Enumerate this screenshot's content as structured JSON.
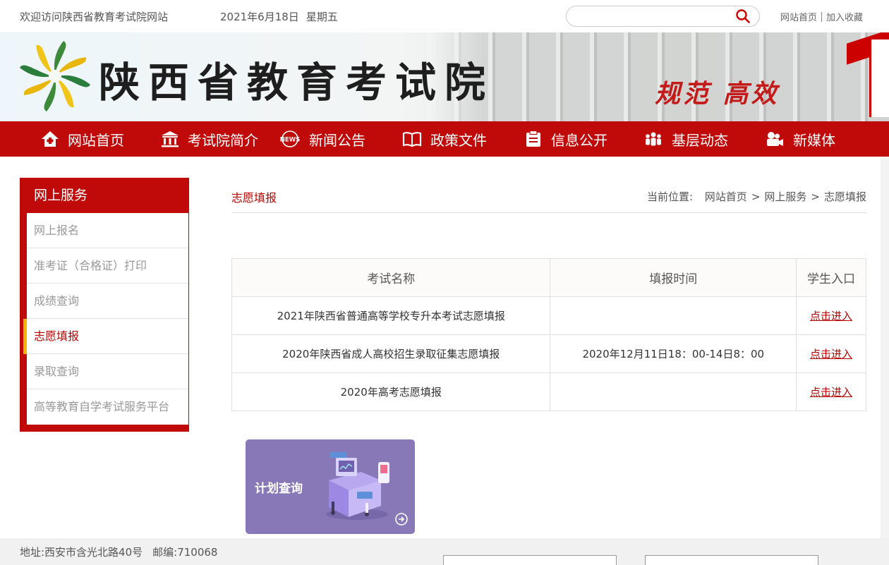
{
  "topbar": {
    "welcome": "欢迎访问陕西省教育考试院网站",
    "date": "2021年6月18日",
    "weekday": "星期五",
    "search_placeholder": "",
    "links": [
      "网站首页",
      "加入收藏"
    ]
  },
  "banner": {
    "site_name": "陕西省教育考试院",
    "slogan": "规范 高效"
  },
  "nav": [
    {
      "label": "网站首页",
      "icon": "home-icon"
    },
    {
      "label": "考试院简介",
      "icon": "building-icon"
    },
    {
      "label": "新闻公告",
      "icon": "news-icon"
    },
    {
      "label": "政策文件",
      "icon": "book-icon"
    },
    {
      "label": "信息公开",
      "icon": "clipboard-icon"
    },
    {
      "label": "基层动态",
      "icon": "people-icon"
    },
    {
      "label": "新媒体",
      "icon": "camera-icon"
    }
  ],
  "sidebar": {
    "title": "网上服务",
    "items": [
      {
        "label": "网上报名"
      },
      {
        "label": "准考证（合格证）打印"
      },
      {
        "label": "成绩查询"
      },
      {
        "label": "志愿填报"
      },
      {
        "label": "录取查询"
      },
      {
        "label": "高等教育自学考试服务平台"
      }
    ],
    "active_index": 3
  },
  "main": {
    "title": "志愿填报",
    "breadcrumb": {
      "prefix": "当前位置:",
      "items": [
        "网站首页",
        "网上服务",
        "志愿填报"
      ]
    },
    "table": {
      "headers": [
        "考试名称",
        "填报时间",
        "学生入口"
      ],
      "rows": [
        {
          "name": "2021年陕西省普通高等学校专升本考试志愿填报",
          "time": "",
          "link": "点击进入"
        },
        {
          "name": "2020年陕西省成人高校招生录取征集志愿填报",
          "time": "2020年12月11日18：00-14日8：00",
          "link": "点击进入"
        },
        {
          "name": "2020年高考志愿填报",
          "time": "",
          "link": "点击进入"
        }
      ]
    },
    "card": {
      "label": "计划查询",
      "color": "#8878b8"
    }
  },
  "footer": {
    "address": "地址:西安市含光北路40号",
    "postcode": "邮编:710068"
  },
  "colors": {
    "brand_red": "#c00a0a",
    "accent_yellow": "#f0b400",
    "active_text": "#bb0000"
  }
}
